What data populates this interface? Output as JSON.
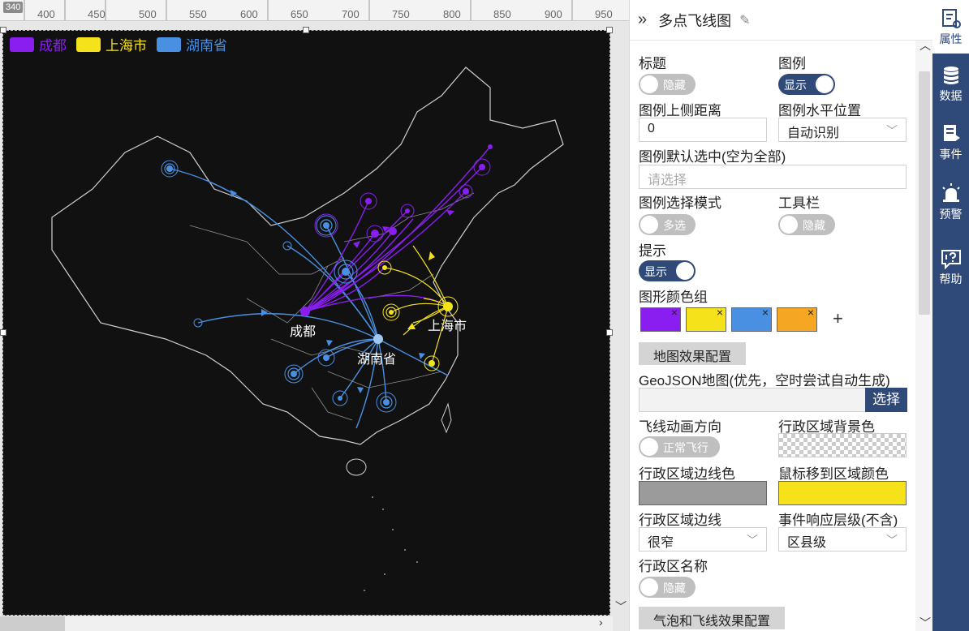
{
  "ruler": {
    "corner": "340",
    "ticks": [
      "400",
      "450",
      "500",
      "550",
      "600",
      "650",
      "700",
      "750",
      "800",
      "850",
      "900",
      "950"
    ]
  },
  "map": {
    "legend": [
      {
        "label": "成都",
        "color": "#8a1ef0"
      },
      {
        "label": "上海市",
        "color": "#f5e21b"
      },
      {
        "label": "湖南省",
        "color": "#4a90e2"
      }
    ],
    "city_labels": {
      "chengdu": "成都",
      "shanghai": "上海市",
      "hunan": "湖南省"
    }
  },
  "panel": {
    "title": "多点飞线图",
    "fields": {
      "title_label": "标题",
      "title_toggle": "隐藏",
      "legend_label": "图例",
      "legend_toggle": "显示",
      "legend_top_label": "图例上侧距离",
      "legend_top_value": "0",
      "legend_h_label": "图例水平位置",
      "legend_h_value": "自动识别",
      "legend_default_label": "图例默认选中(空为全部)",
      "legend_default_placeholder": "请选择",
      "legend_mode_label": "图例选择模式",
      "legend_mode_toggle": "多选",
      "toolbar_label": "工具栏",
      "toolbar_toggle": "隐藏",
      "tooltip_label": "提示",
      "tooltip_toggle": "显示",
      "color_group_label": "图形颜色组",
      "map_effect_button": "地图效果配置",
      "geojson_label": "GeoJSON地图(优先，空时尝试自动生成)",
      "geojson_button": "选择",
      "flight_dir_label": "飞线动画方向",
      "flight_dir_toggle": "正常飞行",
      "region_bg_label": "行政区域背景色",
      "region_border_color_label": "行政区域边线色",
      "hover_color_label": "鼠标移到区域颜色",
      "region_border_label": "行政区域边线",
      "region_border_value": "很窄",
      "event_level_label": "事件响应层级(不含)",
      "event_level_value": "区县级",
      "region_name_label": "行政区名称",
      "region_name_toggle": "隐藏",
      "bubble_button": "气泡和飞线效果配置"
    },
    "color_group": [
      "#8a1ef0",
      "#f5e21b",
      "#4a90e2",
      "#f5a623"
    ],
    "region_border_color": "#9b9b9b",
    "hover_color": "#f5e21b"
  },
  "sidenav": [
    {
      "label": "属性",
      "icon": "properties-icon",
      "active": true
    },
    {
      "label": "数据",
      "icon": "database-icon",
      "active": false
    },
    {
      "label": "事件",
      "icon": "event-icon",
      "active": false
    },
    {
      "label": "预警",
      "icon": "alarm-icon",
      "active": false
    },
    {
      "label": "帮助",
      "icon": "help-icon",
      "active": false
    }
  ]
}
